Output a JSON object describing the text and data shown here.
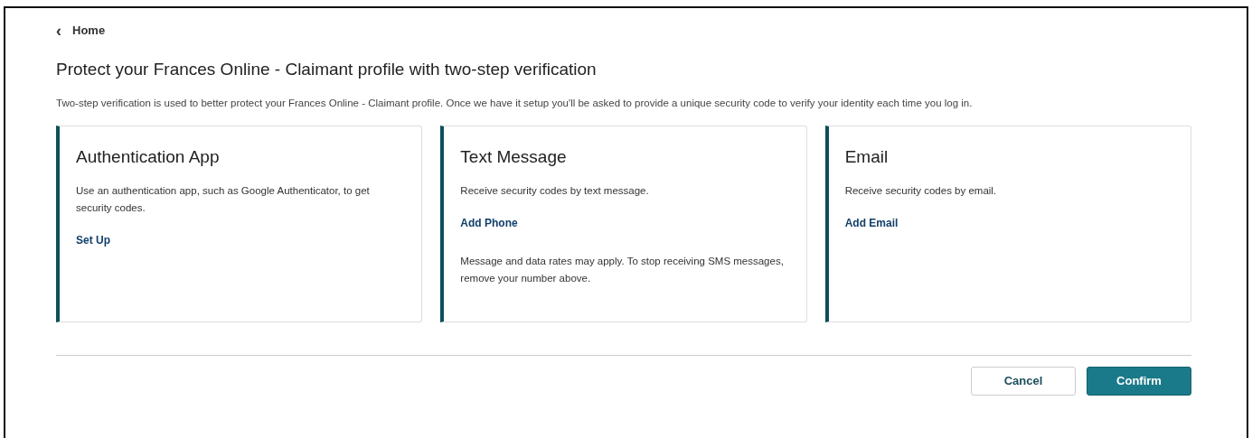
{
  "back_link": {
    "icon": "‹",
    "label": "Home"
  },
  "title": "Protect your Frances Online - Claimant profile with two-step verification",
  "description": "Two-step verification is used to better protect your Frances Online - Claimant profile. Once we have it setup you'll be asked to provide a unique security code to verify your identity each time you log in.",
  "methods": [
    {
      "title": "Authentication App",
      "description": "Use an authentication app, such as Google Authenticator, to get security codes.",
      "link": "Set Up"
    },
    {
      "title": "Text Message",
      "description": "Receive security codes by text message.",
      "link": "Add Phone",
      "note": "Message and data rates may apply. To stop receiving SMS messages, remove your number above."
    },
    {
      "title": "Email",
      "description": "Receive security codes by email.",
      "link": "Add Email"
    }
  ],
  "buttons": [
    {
      "label": "Cancel",
      "kind": "secondary"
    },
    {
      "label": "Confirm",
      "kind": "primary"
    }
  ]
}
